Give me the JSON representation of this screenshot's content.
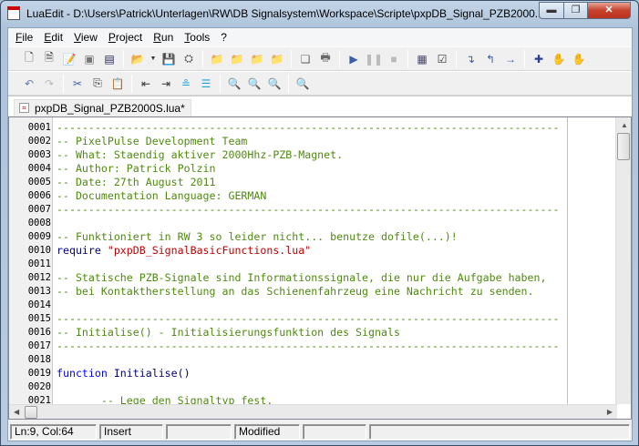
{
  "window": {
    "title": "LuaEdit - D:\\Users\\Patrick\\Unterlagen\\RW\\DB Signalsystem\\Workspace\\Scripte\\pxpDB_Signal_PZB2000..."
  },
  "menu": [
    {
      "label": "File",
      "key": "F",
      "rest": "ile"
    },
    {
      "label": "Edit",
      "key": "E",
      "rest": "dit"
    },
    {
      "label": "View",
      "key": "V",
      "rest": "iew"
    },
    {
      "label": "Project",
      "key": "P",
      "rest": "roject"
    },
    {
      "label": "Run",
      "key": "R",
      "rest": "un"
    },
    {
      "label": "Tools",
      "key": "T",
      "rest": "ools"
    },
    {
      "label": "?",
      "key": "?",
      "rest": ""
    }
  ],
  "tab": {
    "label": "pxpDB_Signal_PZB2000S.lua*"
  },
  "code": [
    {
      "n": "0001",
      "t": "c",
      "v": "-------------------------------------------------------------------------------"
    },
    {
      "n": "0002",
      "t": "c",
      "v": "-- PixelPulse Development Team"
    },
    {
      "n": "0003",
      "t": "c",
      "v": "-- What: Staendig aktiver 2000Hhz-PZB-Magnet."
    },
    {
      "n": "0004",
      "t": "c",
      "v": "-- Author: Patrick Polzin"
    },
    {
      "n": "0005",
      "t": "c",
      "v": "-- Date: 27th August 2011"
    },
    {
      "n": "0006",
      "t": "c",
      "v": "-- Documentation Language: GERMAN"
    },
    {
      "n": "0007",
      "t": "c",
      "v": "-------------------------------------------------------------------------------"
    },
    {
      "n": "0008",
      "t": "c",
      "v": ""
    },
    {
      "n": "0009",
      "t": "c",
      "v": "-- Funktioniert in RW 3 so leider nicht... benutze dofile(...)!"
    },
    {
      "n": "0010",
      "t": "req",
      "kw": "require ",
      "s": "\"pxpDB_SignalBasicFunctions.lua\""
    },
    {
      "n": "0011",
      "t": "c",
      "v": ""
    },
    {
      "n": "0012",
      "t": "c",
      "v": "-- Statische PZB-Signale sind Informationssignale, die nur die Aufgabe haben,"
    },
    {
      "n": "0013",
      "t": "c",
      "v": "-- bei Kontaktherstellung an das Schienenfahrzeug eine Nachricht zu senden."
    },
    {
      "n": "0014",
      "t": "c",
      "v": ""
    },
    {
      "n": "0015",
      "t": "c",
      "v": "-------------------------------------------------------------------------------"
    },
    {
      "n": "0016",
      "t": "c",
      "v": "-- Initialise() - Initialisierungsfunktion des Signals"
    },
    {
      "n": "0017",
      "t": "c",
      "v": "-------------------------------------------------------------------------------"
    },
    {
      "n": "0018",
      "t": "c",
      "v": ""
    },
    {
      "n": "0019",
      "t": "fn",
      "kw": "function ",
      "id": "Initialise()"
    },
    {
      "n": "0020",
      "t": "c",
      "v": ""
    },
    {
      "n": "0021",
      "t": "c",
      "v": "       -- Lege den Signaltyp fest."
    }
  ],
  "status": {
    "position": "Ln:9, Col:64",
    "mode": "Insert",
    "blank1": "",
    "modified": "Modified",
    "blank2": "",
    "blank3": ""
  }
}
